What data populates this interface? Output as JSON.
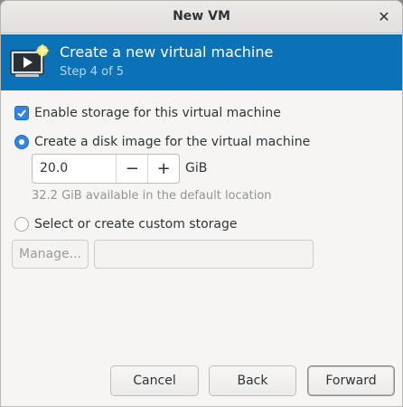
{
  "window": {
    "title": "New VM",
    "close_glyph": "✕"
  },
  "header": {
    "title": "Create a new virtual machine",
    "step": "Step 4 of 5",
    "icon": "virtual-machine-new-icon",
    "accent": "#0b72b7"
  },
  "storage": {
    "enable_label": "Enable storage for this virtual machine",
    "enable_checked": true,
    "disk_image_label": "Create a disk image for the virtual machine",
    "disk_image_selected": true,
    "size_value": "20.0",
    "decrement_glyph": "−",
    "increment_glyph": "+",
    "size_unit": "GiB",
    "available_text": "32.2 GiB available in the default location",
    "custom_label": "Select or create custom storage",
    "custom_selected": false,
    "manage_label": "Manage...",
    "custom_path_value": ""
  },
  "footer": {
    "cancel_label": "Cancel",
    "back_label": "Back",
    "forward_label": "Forward"
  }
}
